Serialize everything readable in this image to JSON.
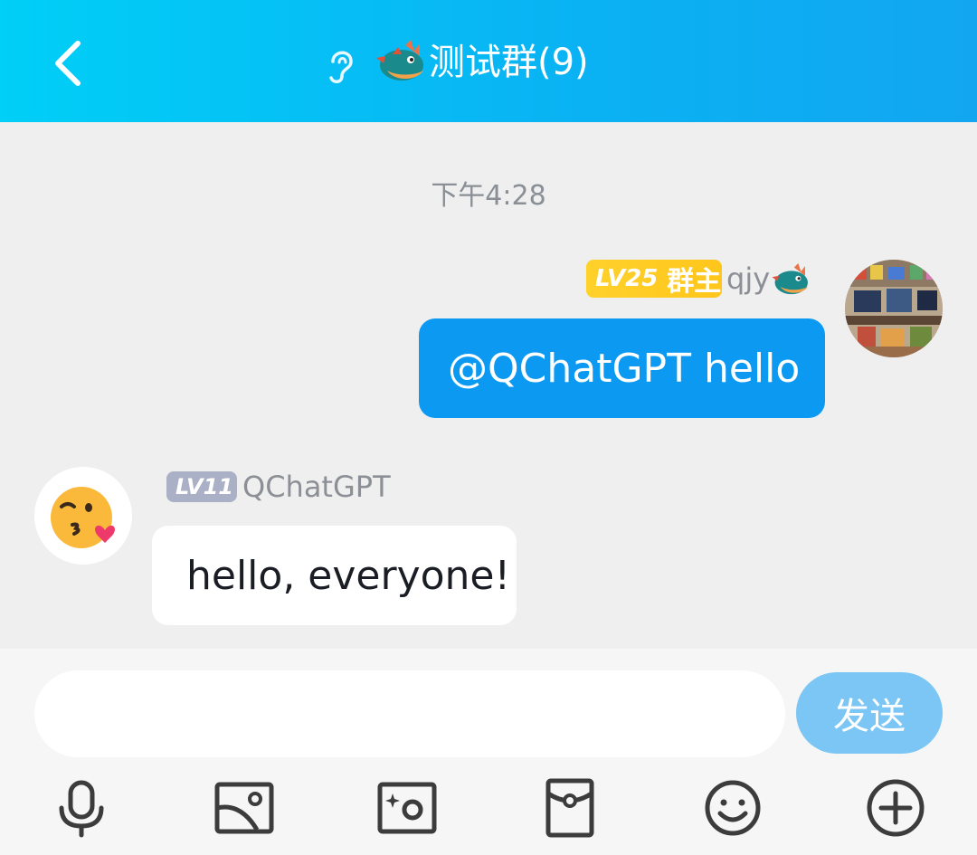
{
  "header": {
    "title": "测试群(9)",
    "back_icon": "chevron-left-icon",
    "ear_icon": "ear-icon",
    "title_emoji": "dragon-emoji"
  },
  "chat": {
    "timestamp": "下午4:28",
    "messages": [
      {
        "sender": "qjy",
        "level": "LV25",
        "role": "群主",
        "text": "@QChatGPT hello",
        "direction": "outgoing"
      },
      {
        "sender": "QChatGPT",
        "level": "LV11",
        "text": "hello, everyone!",
        "direction": "incoming"
      }
    ]
  },
  "input": {
    "placeholder": "",
    "value": "",
    "send_label": "发送"
  },
  "toolbar": {
    "items": [
      "microphone-icon",
      "image-icon",
      "camera-icon",
      "red-packet-icon",
      "emoji-icon",
      "plus-icon"
    ]
  },
  "colors": {
    "header_start": "#00cff7",
    "header_end": "#12a6f1",
    "outgoing_bubble": "#0c99f1",
    "send_button": "#7cc6f5",
    "badge_lv25": "#ffc61c",
    "badge_lv11": "#aab0c6"
  }
}
